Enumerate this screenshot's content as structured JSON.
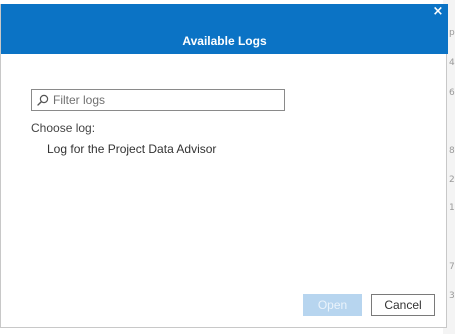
{
  "dialog": {
    "title": "Available Logs",
    "close_icon": "close-icon",
    "close_glyph": "×"
  },
  "filter": {
    "placeholder": "Filter logs",
    "value": "",
    "icon": "search-icon"
  },
  "choose_label": "Choose log:",
  "logs": [
    {
      "label": "Log for the Project Data Advisor"
    }
  ],
  "buttons": {
    "open": {
      "label": "Open",
      "enabled": false
    },
    "cancel": {
      "label": "Cancel",
      "enabled": true
    }
  },
  "background_edge_chars": [
    "p",
    "4",
    "6",
    "8",
    "2",
    "1",
    "7",
    "3"
  ],
  "colors": {
    "header": "#0b73c5",
    "open_disabled": "#b7d5ef"
  }
}
